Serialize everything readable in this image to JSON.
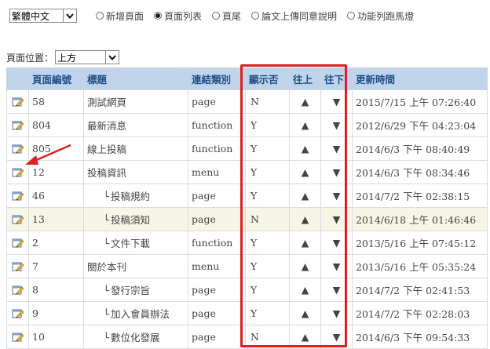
{
  "top": {
    "language_select": {
      "selected": "繁體中文"
    },
    "mode_options": [
      {
        "label": "新增頁面",
        "selected": false
      },
      {
        "label": "頁面列表",
        "selected": true
      },
      {
        "label": "頁尾",
        "selected": false
      },
      {
        "label": "論文上傳同意說明",
        "selected": false
      },
      {
        "label": "功能列跑馬燈",
        "selected": false
      }
    ]
  },
  "position": {
    "label": "頁面位置：",
    "selected": "上方"
  },
  "table": {
    "headers": {
      "id": "頁面編號",
      "title": "標題",
      "link_type": "連結類別",
      "visible": "顯示否",
      "up": "往上",
      "down": "往下",
      "updated": "更新時間"
    },
    "rows": [
      {
        "id": "58",
        "prefix": "",
        "title": "測試網頁",
        "link_type": "page",
        "visible": "N",
        "up": "▲",
        "down": "▼",
        "updated": "2015/7/15 上午 07:26:40"
      },
      {
        "id": "804",
        "prefix": "",
        "title": "最新消息",
        "link_type": "function",
        "visible": "Y",
        "up": "▲",
        "down": "▼",
        "updated": "2012/6/29 下午 04:23:04"
      },
      {
        "id": "805",
        "prefix": "",
        "title": "線上投稿",
        "link_type": "function",
        "visible": "Y",
        "up": "▲",
        "down": "▼",
        "updated": "2014/6/3 下午 08:40:49"
      },
      {
        "id": "12",
        "prefix": "",
        "title": "投稿資訊",
        "link_type": "menu",
        "visible": "Y",
        "up": "▲",
        "down": "▼",
        "updated": "2014/6/3 下午 08:34:46"
      },
      {
        "id": "46",
        "prefix": "└",
        "title": "投稿規約",
        "link_type": "page",
        "visible": "Y",
        "up": "▲",
        "down": "▼",
        "updated": "2014/7/2 下午 02:38:15"
      },
      {
        "id": "13",
        "prefix": "└",
        "title": "投稿須知",
        "link_type": "page",
        "visible": "N",
        "up": "▲",
        "down": "▼",
        "updated": "2014/6/18 上午 01:46:46"
      },
      {
        "id": "2",
        "prefix": "└",
        "title": "文件下載",
        "link_type": "function",
        "visible": "Y",
        "up": "▲",
        "down": "▼",
        "updated": "2013/5/16 上午 07:45:12"
      },
      {
        "id": "7",
        "prefix": "",
        "title": "關於本刊",
        "link_type": "menu",
        "visible": "Y",
        "up": "▲",
        "down": "▼",
        "updated": "2013/5/16 上午 05:35:24"
      },
      {
        "id": "8",
        "prefix": "└",
        "title": "發行宗旨",
        "link_type": "page",
        "visible": "Y",
        "up": "▲",
        "down": "▼",
        "updated": "2014/7/2 下午 02:41:53"
      },
      {
        "id": "9",
        "prefix": "└",
        "title": "加入會員辦法",
        "link_type": "page",
        "visible": "Y",
        "up": "▲",
        "down": "▼",
        "updated": "2014/7/2 下午 02:28:03"
      },
      {
        "id": "10",
        "prefix": "└",
        "title": "數位化發展",
        "link_type": "page",
        "visible": "N",
        "up": "▲",
        "down": "▼",
        "updated": "2014/6/3 下午 09:54:33"
      }
    ]
  },
  "highlight_color": "#e02020",
  "header_color": "#bfd4ea"
}
